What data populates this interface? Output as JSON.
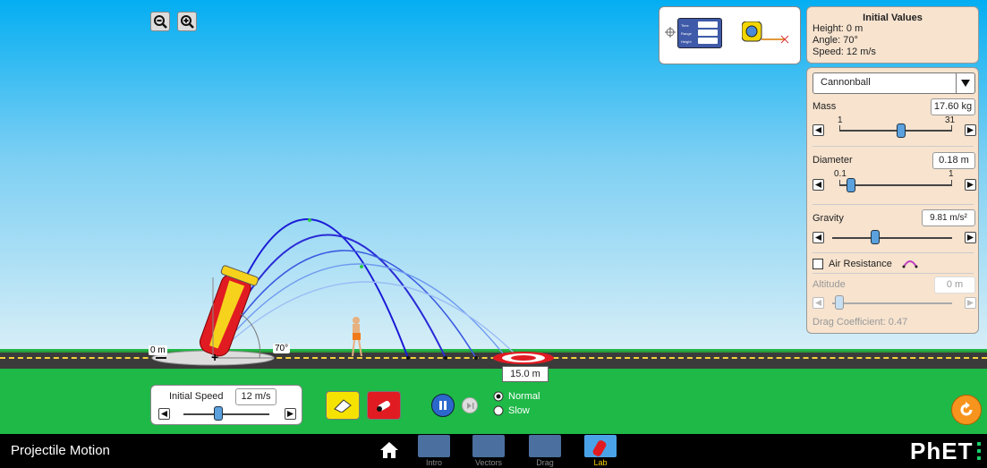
{
  "zoom": {
    "out_icon": "zoom-out-icon",
    "in_icon": "zoom-in-icon"
  },
  "tools": {
    "stopwatch_labels": [
      "Time",
      "Range",
      "Height"
    ]
  },
  "initial_values": {
    "title": "Initial Values",
    "height": "Height: 0 m",
    "angle": "Angle: 70°",
    "speed": "Speed: 12 m/s"
  },
  "params": {
    "projectile": "Cannonball",
    "mass_label": "Mass",
    "mass_value": "17.60 kg",
    "mass_min": "1",
    "mass_max": "31",
    "diameter_label": "Diameter",
    "diameter_value": "0.18 m",
    "diameter_min": "0.1",
    "diameter_max": "1",
    "gravity_label": "Gravity",
    "gravity_value": "9.81 m/s²",
    "air_resistance_label": "Air Resistance",
    "altitude_label": "Altitude",
    "altitude_value": "0 m",
    "drag_label": "Drag Coefficient: 0.47"
  },
  "scene": {
    "height_label": "0 m",
    "angle_label": "70°",
    "target_distance": "15.0 m"
  },
  "controls": {
    "initial_speed_label": "Initial Speed",
    "initial_speed_value": "12 m/s",
    "speed_normal": "Normal",
    "speed_slow": "Slow",
    "speed_selected": "Normal"
  },
  "navbar": {
    "title": "Projectile Motion",
    "tabs": [
      "Intro",
      "Vectors",
      "Drag",
      "Lab"
    ],
    "active_tab": "Lab",
    "brand": "PhET"
  },
  "colors": {
    "trajectory": "#1a1ad6",
    "panel": "#f7e3ce",
    "active_tab": "#f5d000"
  }
}
